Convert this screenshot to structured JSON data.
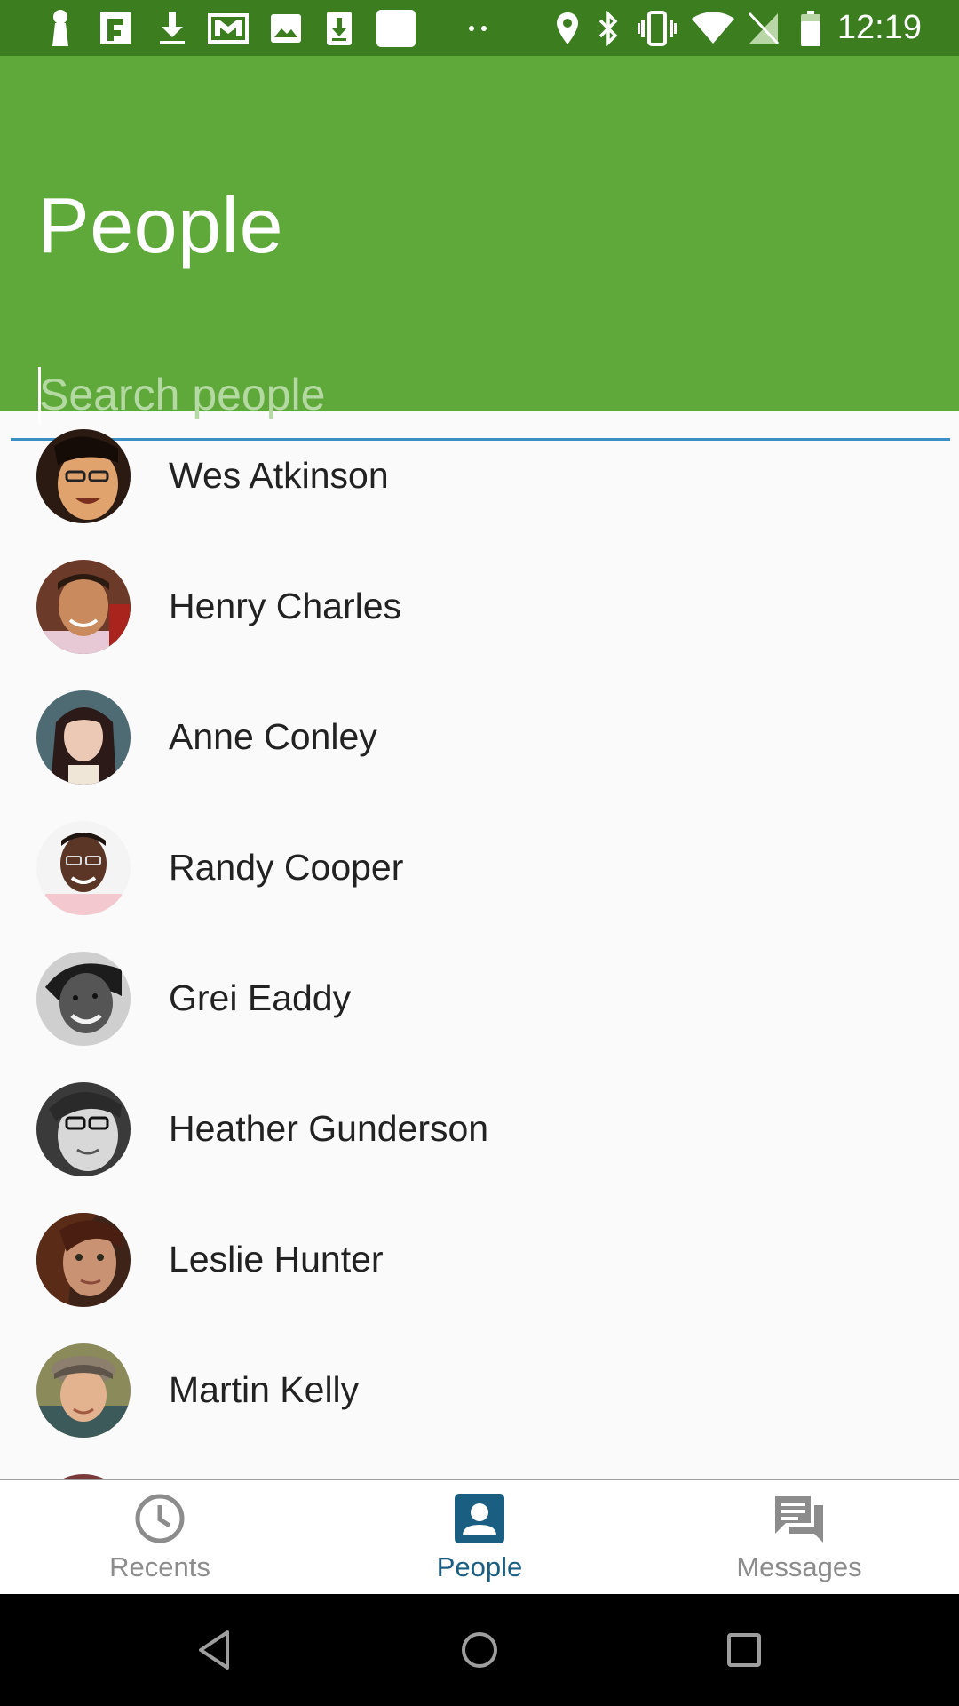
{
  "status_bar": {
    "time": "12:19",
    "left_icons": [
      "keyhole-icon",
      "flipboard-icon",
      "download-icon",
      "gmail-icon",
      "image-icon",
      "download-box-icon",
      "blank-square-icon",
      "more-dots-icon"
    ],
    "right_icons": [
      "location-icon",
      "bluetooth-icon",
      "vibrate-icon",
      "wifi-icon",
      "no-sim-icon",
      "battery-icon"
    ]
  },
  "header": {
    "title": "People",
    "search_placeholder": "Search people",
    "background_color": "#5fa93a"
  },
  "people": [
    {
      "name": "Wes Atkinson"
    },
    {
      "name": "Henry Charles"
    },
    {
      "name": "Anne Conley"
    },
    {
      "name": "Randy Cooper"
    },
    {
      "name": "Grei Eaddy"
    },
    {
      "name": "Heather Gunderson"
    },
    {
      "name": "Leslie Hunter"
    },
    {
      "name": "Martin Kelly"
    }
  ],
  "bottom_nav": {
    "items": [
      {
        "label": "Recents",
        "icon": "clock-icon",
        "active": false
      },
      {
        "label": "People",
        "icon": "person-icon",
        "active": true
      },
      {
        "label": "Messages",
        "icon": "messages-icon",
        "active": false
      }
    ],
    "active_color": "#1a5e82",
    "inactive_color": "#8c8c8c"
  },
  "system_nav": {
    "buttons": [
      "back-icon",
      "home-icon",
      "recents-square-icon"
    ]
  }
}
